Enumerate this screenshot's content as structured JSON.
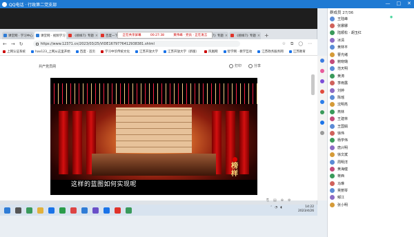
{
  "app": {
    "title": "QQ电话 · 行政第二党支部",
    "win_controls": [
      "—",
      "□",
      "✕"
    ]
  },
  "browser": {
    "tabs": [
      {
        "label": "课堂网 · 学习中心",
        "color": "#2f7cd6"
      },
      {
        "label": "课堂网 · 视频学习",
        "color": "#2f7cd6"
      },
      {
        "label": "《榜样7》专题",
        "color": "#e0332a"
      },
      {
        "label": "百度一下",
        "color": "#e0332a"
      },
      {
        "label": "共产党员网",
        "color": "#e0332a"
      },
      {
        "label": "《榜样7》专题",
        "color": "#e0332a"
      },
      {
        "label": "《榜样7》专题",
        "color": "#e0332a"
      },
      {
        "label": "《榜样7》专题",
        "color": "#e0332a"
      }
    ],
    "new_tab": "+",
    "recording": {
      "label": "正在共享屏幕",
      "time": "00:27:38",
      "info": "黄伟峰 · 党员 · 正在发言"
    },
    "nav": {
      "back": "←",
      "forward": "→",
      "refresh": "↻"
    },
    "url": "https://www.12371.cn/2023/03/25/VIDE1679776412938381.shtml",
    "bookmarks": [
      {
        "label": "上网认证系统",
        "color": "#c00"
      },
      {
        "label": "hao123_上网从这里开始",
        "color": "#1a73e8"
      },
      {
        "label": "百度 · 首页",
        "color": "#1a73e8"
      },
      {
        "label": "学习中华传统文化",
        "color": "#c00"
      },
      {
        "label": "江苏开放大学",
        "color": "#1a73e8"
      },
      {
        "label": "江苏开放大学（新版）",
        "color": "#1a73e8"
      },
      {
        "label": "风凰网",
        "color": "#c00"
      },
      {
        "label": "智学网 · 教学互动",
        "color": "#1a73e8"
      },
      {
        "label": "江苏政务服务网",
        "color": "#1a73e8"
      },
      {
        "label": "江苏教育",
        "color": "#1a73e8"
      }
    ],
    "breadcrumb": "共产党员网",
    "page_tools": [
      "打印",
      "分享"
    ],
    "video": {
      "subtitle": "这样的蓝图如何实现呢",
      "badge_lines": [
        "榜",
        "样"
      ]
    }
  },
  "taskbar": {
    "time": "14:22",
    "date": "2023/4/26"
  },
  "members": {
    "header": "群成员 27/36",
    "list": [
      {
        "name": "王陆峰",
        "color": "#5b8bd6"
      },
      {
        "name": "张娜娜",
        "color": "#d0625c"
      },
      {
        "name": "陆顺松 · 胡玉红",
        "color": "#3a9a5b"
      },
      {
        "name": "冰清",
        "color": "#8c6bc4"
      },
      {
        "name": "黄林平",
        "color": "#5b8bd6"
      },
      {
        "name": "曹光绪",
        "color": "#d59b38"
      },
      {
        "name": "鲍晓璐",
        "color": "#c44b7a"
      },
      {
        "name": "范天明",
        "color": "#5b8bd6"
      },
      {
        "name": "黄涛",
        "color": "#3a9a5b"
      },
      {
        "name": "李雨露",
        "color": "#d0625c"
      },
      {
        "name": "刘婷",
        "color": "#8c6bc4"
      },
      {
        "name": "陈瑶",
        "color": "#5b8bd6"
      },
      {
        "name": "沈明亮",
        "color": "#d59b38"
      },
      {
        "name": "燕林",
        "color": "#3a9a5b"
      },
      {
        "name": "王建林",
        "color": "#c44b7a"
      },
      {
        "name": "王国娟",
        "color": "#5b8bd6"
      },
      {
        "name": "徐伟",
        "color": "#d0625c"
      },
      {
        "name": "杨学伟",
        "color": "#3a9a5b"
      },
      {
        "name": "唐兴明",
        "color": "#8c6bc4"
      },
      {
        "name": "徐文斌",
        "color": "#d59b38"
      },
      {
        "name": "周明洋",
        "color": "#5b8bd6"
      },
      {
        "name": "黄海健",
        "color": "#c44b7a"
      },
      {
        "name": "蒋西",
        "color": "#3a9a5b"
      },
      {
        "name": "马琳",
        "color": "#d0625c"
      },
      {
        "name": "吴丽琴",
        "color": "#5b8bd6"
      },
      {
        "name": "郁江",
        "color": "#8c6bc4"
      },
      {
        "name": "张小明",
        "color": "#d59b38"
      }
    ]
  }
}
